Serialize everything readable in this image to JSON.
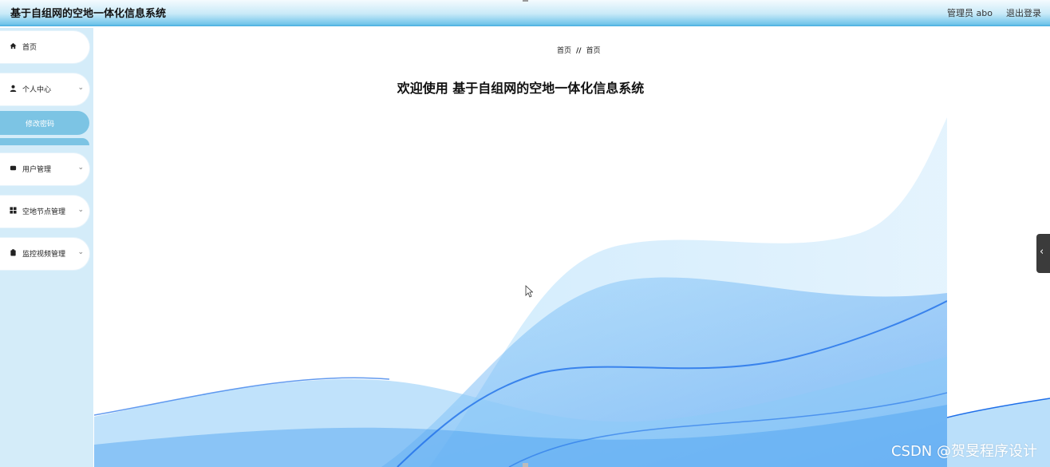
{
  "header": {
    "title": "基于自组网的空地一体化信息系统",
    "user_label": "管理员 abo",
    "logout_label": "退出登录"
  },
  "sidebar": {
    "items": [
      {
        "label": "首页",
        "icon": "home-icon"
      },
      {
        "label": "个人中心",
        "icon": "user-icon"
      },
      {
        "label": "用户管理",
        "icon": "users-icon"
      },
      {
        "label": "空地节点管理",
        "icon": "grid-icon"
      },
      {
        "label": "监控视频管理",
        "icon": "clipboard-icon"
      }
    ],
    "sub_items": [
      {
        "label": "修改密码"
      }
    ]
  },
  "main": {
    "breadcrumb": [
      "首页",
      "//",
      "首页"
    ],
    "welcome": "欢迎使用 基于自组网的空地一体化信息系统"
  },
  "watermark": "CSDN @贺旻程序设计",
  "colors": {
    "header_accent": "#56b6e3",
    "sidebar_bg": "#d4ecf9",
    "active_item": "#7cc4e4",
    "wave_blue": "#1f6fe8"
  }
}
